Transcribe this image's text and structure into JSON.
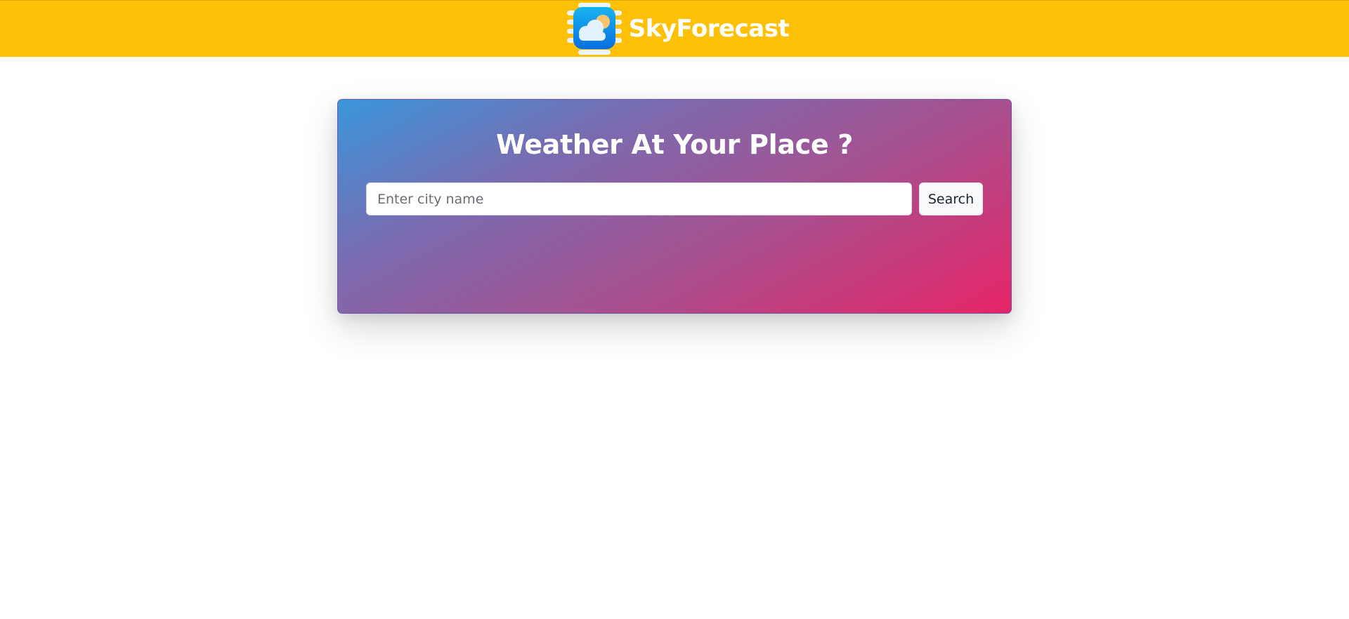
{
  "navbar": {
    "brand_name": "SkyForecast",
    "logo_icon": "weather-app-icon",
    "background_color": "#ffc107"
  },
  "card": {
    "title": "Weather At Your Place ?",
    "gradient_start_color": "#3a96db",
    "gradient_end_color": "#e62466"
  },
  "search": {
    "placeholder": "Enter city name",
    "value": "",
    "button_label": "Search"
  }
}
